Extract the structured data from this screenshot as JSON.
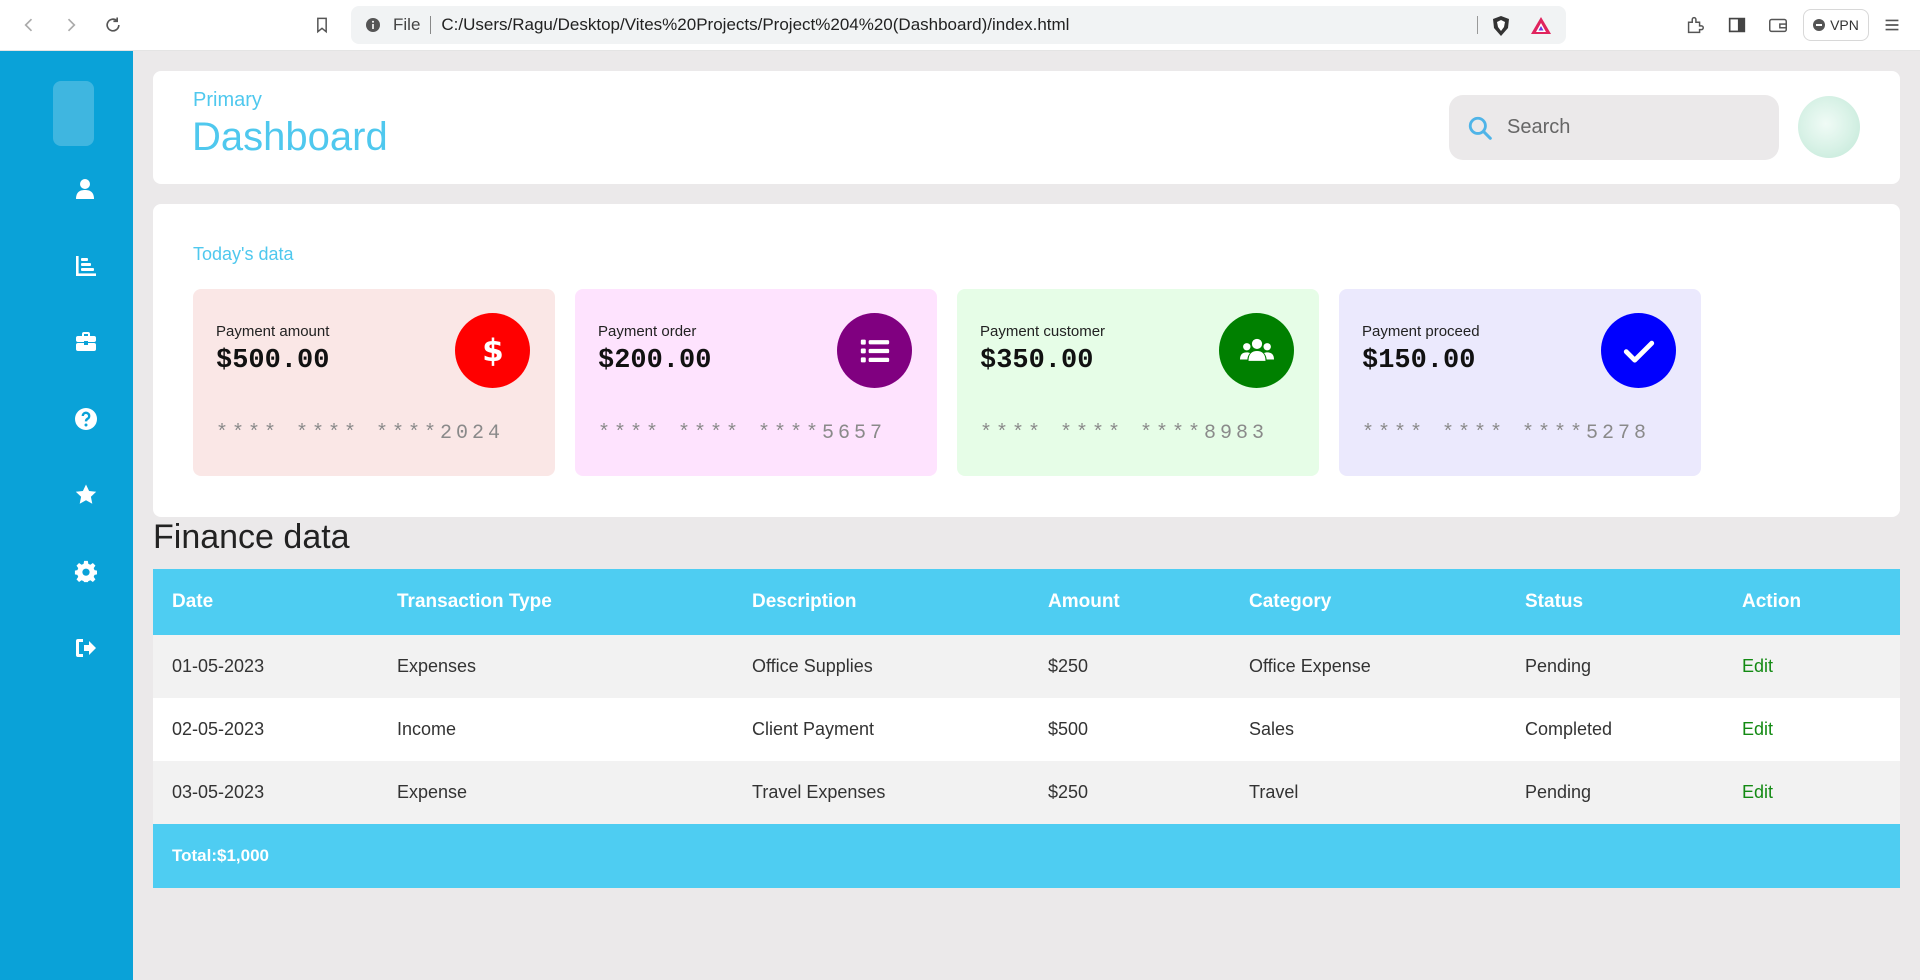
{
  "browser": {
    "file_label": "File",
    "url": "C:/Users/Ragu/Desktop/Vites%20Projects/Project%204%20(Dashboard)/index.html",
    "vpn_label": "VPN"
  },
  "sidebar": {
    "items": [
      {
        "icon": "user-icon"
      },
      {
        "icon": "chart-icon"
      },
      {
        "icon": "briefcase-icon"
      },
      {
        "icon": "question-icon"
      },
      {
        "icon": "star-icon"
      },
      {
        "icon": "gear-icon"
      },
      {
        "icon": "logout-icon"
      }
    ]
  },
  "header": {
    "subtitle": "Primary",
    "title": "Dashboard",
    "search_placeholder": "Search"
  },
  "today": {
    "label": "Today's data",
    "cards": [
      {
        "title": "Payment amount",
        "amount": "$500.00",
        "number": "**** **** ****2024",
        "icon": "dollar-icon",
        "bg": "#fae7e6",
        "icon_bg": "#ff0000"
      },
      {
        "title": "Payment order",
        "amount": "$200.00",
        "number": "**** **** ****5657",
        "icon": "list-icon",
        "bg": "#fee3fe",
        "icon_bg": "#800080"
      },
      {
        "title": "Payment customer",
        "amount": "$350.00",
        "number": "**** **** ****8983",
        "icon": "users-icon",
        "bg": "#e6fde7",
        "icon_bg": "#008000"
      },
      {
        "title": "Payment proceed",
        "amount": "$150.00",
        "number": "**** **** ****5278",
        "icon": "check-icon",
        "bg": "#ebe9fd",
        "icon_bg": "#0000ff"
      }
    ]
  },
  "finance": {
    "title": "Finance data",
    "columns": [
      "Date",
      "Transaction Type",
      "Description",
      "Amount",
      "Category",
      "Status",
      "Action"
    ],
    "rows": [
      [
        "01-05-2023",
        "Expenses",
        "Office Supplies",
        "$250",
        "Office Expense",
        "Pending",
        "Edit"
      ],
      [
        "02-05-2023",
        "Income",
        "Client Payment",
        "$500",
        "Sales",
        "Completed",
        "Edit"
      ],
      [
        "03-05-2023",
        "Expense",
        "Travel Expenses",
        "$250",
        "Travel",
        "Pending",
        "Edit"
      ]
    ],
    "total": "Total:$1,000"
  },
  "colors": {
    "sidebar": "#0aa2d8",
    "accent": "#4fc8ee",
    "table_header": "#4ecdf2",
    "action_link": "#138a13"
  }
}
